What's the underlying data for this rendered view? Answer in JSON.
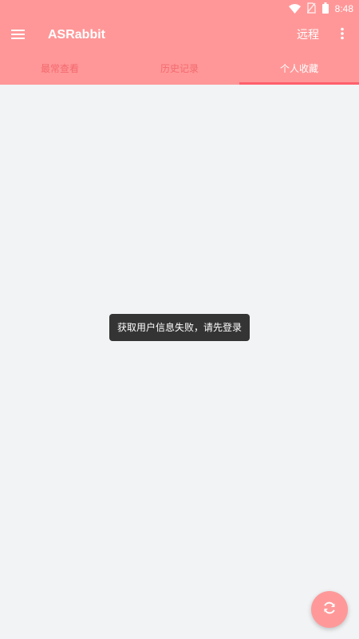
{
  "colors": {
    "header_bg": "#ff9798",
    "content_bg": "#f2f3f5",
    "tab_inactive": "#f36a6e",
    "tab_active": "#ffffff",
    "tab_indicator": "#ff5f6c",
    "toast_bg": "#343434",
    "fab_bg": "#ff9999"
  },
  "status_bar": {
    "time": "8:48",
    "icons": [
      "wifi-icon",
      "no-sim-icon",
      "battery-icon"
    ]
  },
  "toolbar": {
    "menu_icon": "hamburger-menu-icon",
    "title": "ASRabbit",
    "remote_label": "远程",
    "more_icon": "more-vertical-icon"
  },
  "tabs": [
    {
      "label": "最常查看",
      "active": false
    },
    {
      "label": "历史记录",
      "active": false
    },
    {
      "label": "个人收藏",
      "active": true
    }
  ],
  "toast": {
    "message": "获取用户信息失败，请先登录"
  },
  "fab": {
    "icon": "refresh-icon"
  }
}
